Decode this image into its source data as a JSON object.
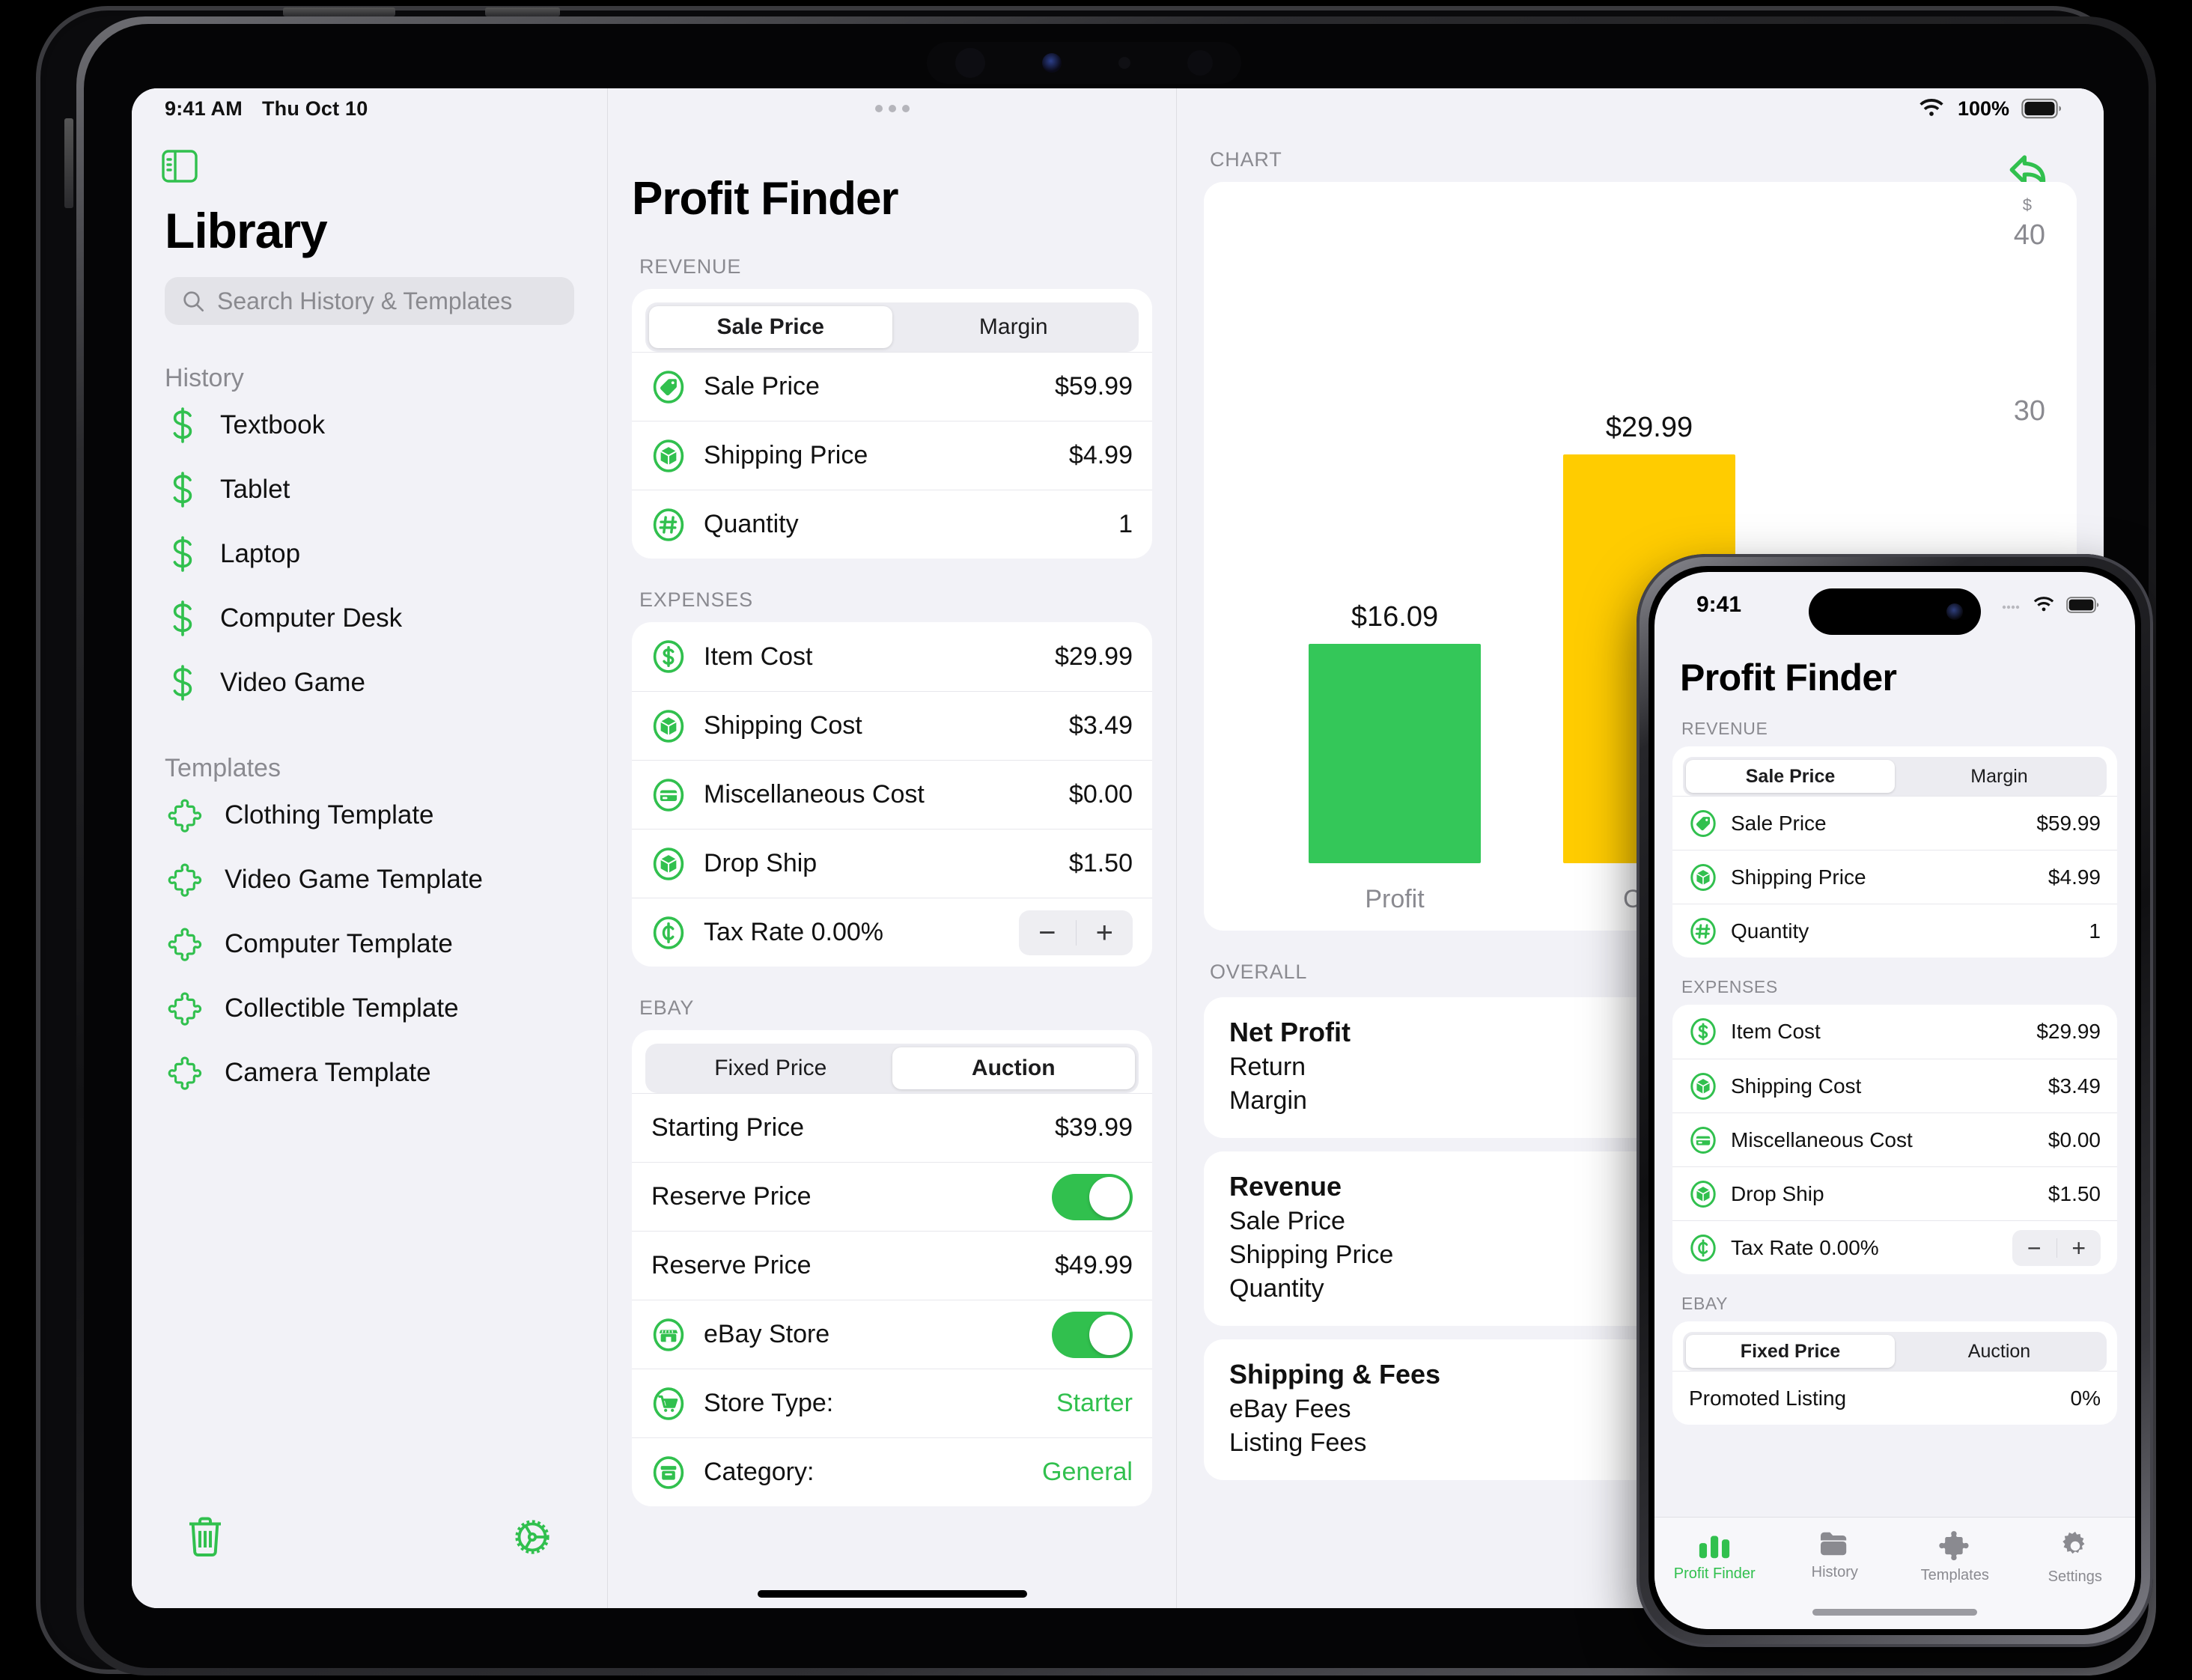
{
  "ipad": {
    "status": {
      "time": "9:41 AM",
      "date": "Thu Oct 10",
      "wifi_icon": "wifi-icon",
      "battery_text": "100%",
      "battery_icon": "battery-icon"
    },
    "sidebar": {
      "toggle_icon": "sidebar-toggle-icon",
      "title": "Library",
      "search_placeholder": "Search History & Templates",
      "search_icon": "search-icon",
      "sections": [
        {
          "label": "History",
          "icon": "dollar-icon",
          "items": [
            "Textbook",
            "Tablet",
            "Laptop",
            "Computer Desk",
            "Video Game"
          ]
        },
        {
          "label": "Templates",
          "icon": "puzzle-icon",
          "items": [
            "Clothing Template",
            "Video Game Template",
            "Computer Template",
            "Collectible Template",
            "Camera Template"
          ]
        }
      ],
      "bottom": {
        "trash_icon": "trash-icon",
        "gear_icon": "gear-icon"
      }
    },
    "middle": {
      "title": "Profit Finder",
      "groups": [
        {
          "label": "REVENUE",
          "segmented": {
            "options": [
              "Sale Price",
              "Margin"
            ],
            "selected": "Sale Price"
          },
          "rows": [
            {
              "icon": "tag-icon",
              "label": "Sale Price",
              "value": "$59.99"
            },
            {
              "icon": "box-icon",
              "label": "Shipping Price",
              "value": "$4.99"
            },
            {
              "icon": "hash-icon",
              "label": "Quantity",
              "value": "1"
            }
          ]
        },
        {
          "label": "EXPENSES",
          "rows": [
            {
              "icon": "dollar-circle-icon",
              "label": "Item Cost",
              "value": "$29.99"
            },
            {
              "icon": "box-icon",
              "label": "Shipping Cost",
              "value": "$3.49"
            },
            {
              "icon": "card-icon",
              "label": "Miscellaneous Cost",
              "value": "$0.00"
            },
            {
              "icon": "box-icon",
              "label": "Drop Ship",
              "value": "$1.50"
            },
            {
              "icon": "cent-icon",
              "label": "Tax Rate",
              "value": "0.00%",
              "stepper": {
                "minus": "−",
                "plus": "+"
              }
            }
          ]
        },
        {
          "label": "EBAY",
          "segmented": {
            "options": [
              "Fixed Price",
              "Auction"
            ],
            "selected": "Auction"
          },
          "rows": [
            {
              "label": "Starting Price",
              "value": "$39.99"
            },
            {
              "label": "Reserve Price",
              "toggle": true
            },
            {
              "label": "Reserve Price",
              "value": "$49.99"
            },
            {
              "icon": "store-icon",
              "label": "eBay Store",
              "toggle": true
            },
            {
              "icon": "cart-icon",
              "label": "Store Type:",
              "value": "Starter",
              "value_green": true
            },
            {
              "icon": "category-icon",
              "label": "Category:",
              "value": "General",
              "value_green": true
            }
          ]
        }
      ]
    },
    "right": {
      "undo_icon": "undo-arrow-icon",
      "chart_label": "CHART",
      "overall_label": "OVERALL",
      "overall_cards": [
        {
          "heading": "Net Profit",
          "rows": [
            "Return",
            "Margin"
          ]
        },
        {
          "heading": "Revenue",
          "rows": [
            "Sale Price",
            "Shipping Price",
            "Quantity"
          ]
        },
        {
          "heading": "Shipping & Fees",
          "rows": [
            "eBay Fees",
            "Listing Fees"
          ]
        }
      ]
    }
  },
  "chart_data": {
    "type": "bar",
    "title": "CHART",
    "categories": [
      "Profit",
      "Cost"
    ],
    "values": [
      16.09,
      29.99
    ],
    "data_labels": [
      "$16.09",
      "$29.99"
    ],
    "colors": [
      "#34c759",
      "#ffcc00"
    ],
    "ylabel": "$",
    "yticks": [
      30,
      40
    ],
    "ytick_labels": [
      "30",
      "40"
    ],
    "ylim": [
      0,
      45
    ],
    "grid": false,
    "legend": "none",
    "axis_unit": "$"
  },
  "iphone": {
    "status": {
      "time": "9:41",
      "signal_icon": "cellular-icon",
      "wifi_icon": "wifi-icon",
      "battery_icon": "battery-icon"
    },
    "title": "Profit Finder",
    "groups": [
      {
        "label": "REVENUE",
        "segmented": {
          "options": [
            "Sale Price",
            "Margin"
          ],
          "selected": "Sale Price"
        },
        "rows": [
          {
            "icon": "tag-icon",
            "label": "Sale Price",
            "value": "$59.99"
          },
          {
            "icon": "box-icon",
            "label": "Shipping Price",
            "value": "$4.99"
          },
          {
            "icon": "hash-icon",
            "label": "Quantity",
            "value": "1"
          }
        ]
      },
      {
        "label": "EXPENSES",
        "rows": [
          {
            "icon": "dollar-circle-icon",
            "label": "Item Cost",
            "value": "$29.99"
          },
          {
            "icon": "box-icon",
            "label": "Shipping Cost",
            "value": "$3.49"
          },
          {
            "icon": "card-icon",
            "label": "Miscellaneous Cost",
            "value": "$0.00"
          },
          {
            "icon": "box-icon",
            "label": "Drop Ship",
            "value": "$1.50"
          },
          {
            "icon": "cent-icon",
            "label": "Tax Rate",
            "value": "0.00%",
            "stepper": {
              "minus": "−",
              "plus": "+"
            }
          }
        ]
      },
      {
        "label": "EBAY",
        "segmented": {
          "options": [
            "Fixed Price",
            "Auction"
          ],
          "selected": "Fixed Price"
        },
        "rows": [
          {
            "label": "Promoted Listing",
            "value": "0%"
          }
        ]
      }
    ],
    "tabs": [
      {
        "label": "Profit Finder",
        "icon": "bar-chart-icon",
        "active": true
      },
      {
        "label": "History",
        "icon": "folder-icon",
        "active": false
      },
      {
        "label": "Templates",
        "icon": "puzzle-icon",
        "active": false
      },
      {
        "label": "Settings",
        "icon": "gear-icon",
        "active": false
      }
    ]
  },
  "colors": {
    "accent": "#31c04e",
    "profit_bar": "#34c759",
    "cost_bar": "#ffcc00",
    "bg": "#f2f2f7"
  }
}
